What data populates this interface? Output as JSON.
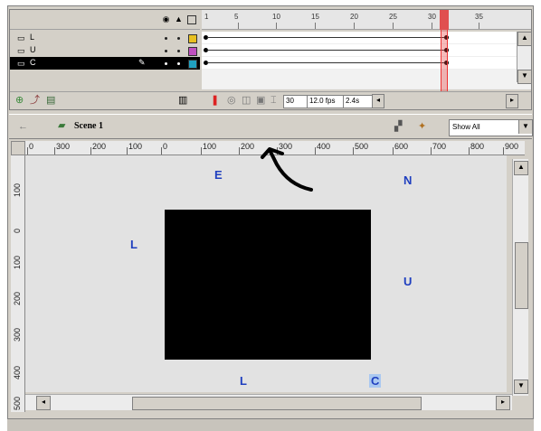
{
  "timeline": {
    "frame_numbers": [
      "1",
      "5",
      "10",
      "15",
      "20",
      "25",
      "30",
      "35"
    ],
    "layers": [
      {
        "name": "L",
        "swatch_color": "#e8c020",
        "selected": false
      },
      {
        "name": "U",
        "swatch_color": "#c050c0",
        "selected": false
      },
      {
        "name": "C",
        "swatch_color": "#20a0c0",
        "selected": true
      }
    ],
    "current_frame": "30",
    "frame_rate": "12.0 fps",
    "elapsed_time": "2.4s"
  },
  "scene": {
    "name": "Scene 1",
    "zoom_value": "Show All"
  },
  "ruler": {
    "top_labels": [
      "0",
      "300",
      "200",
      "100",
      "0",
      "100",
      "200",
      "300",
      "400",
      "500",
      "600",
      "700",
      "800",
      "900"
    ],
    "left_labels": [
      "100",
      "0",
      "100",
      "200",
      "300",
      "400",
      "500"
    ]
  },
  "stage": {
    "labels": {
      "E": "E",
      "N": "N",
      "L_left": "L",
      "U": "U",
      "L_bottom": "L",
      "C": "C"
    },
    "movie_color": "#000000",
    "label_color": "#1f3fbf"
  },
  "icons": [
    "eye-icon",
    "lock-icon",
    "outline-icon",
    "layer-icon",
    "pencil-icon",
    "trash-icon",
    "add-layer-icon",
    "motion-guide-icon",
    "add-folder-icon",
    "back-arrow-icon",
    "scene-icon",
    "edit-scene-icon",
    "edit-symbol-icon",
    "onion-skin-icon",
    "hand-drawn-arrow-icon"
  ]
}
